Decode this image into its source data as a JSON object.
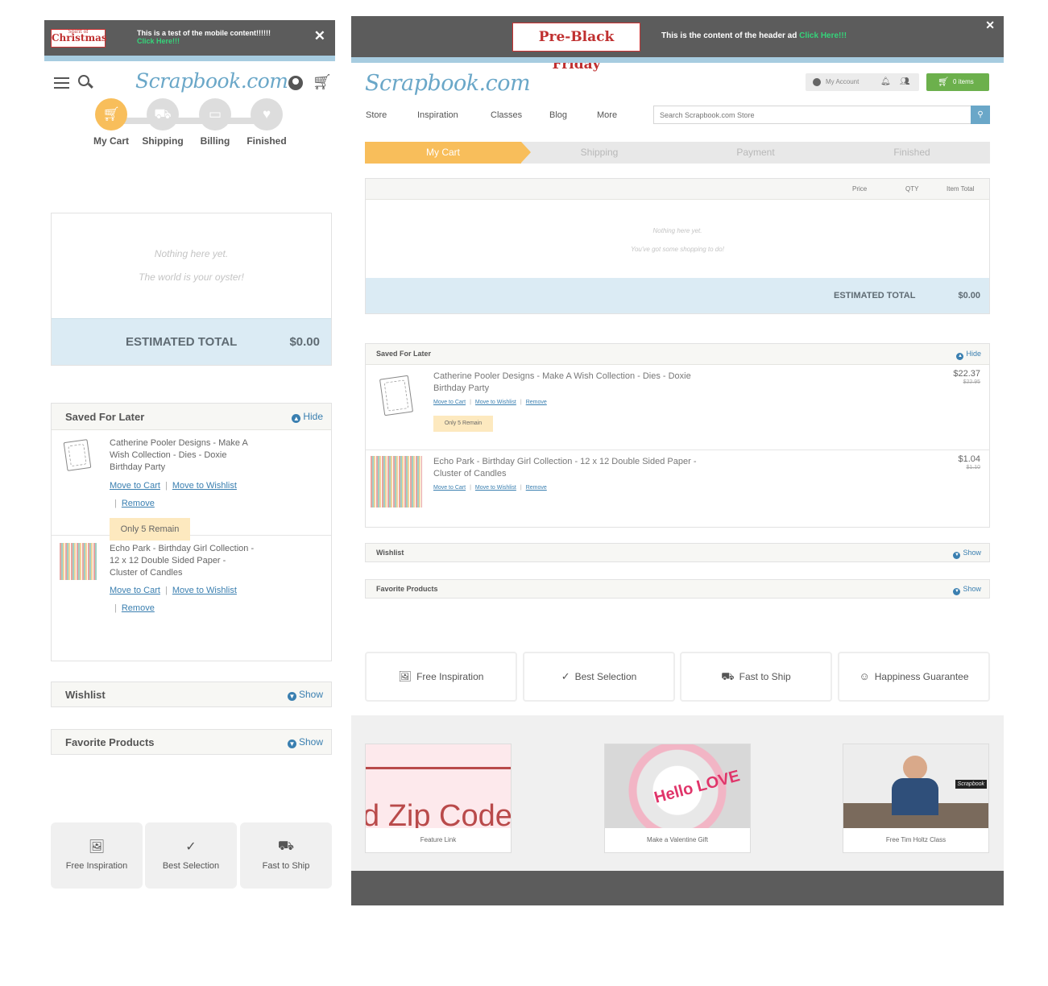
{
  "mobile": {
    "ad": {
      "logo_small": "Spirit of",
      "logo": "Christmas",
      "text": "This is a test of the mobile content!!!!!!",
      "link": "Click Here!!!",
      "close": "✕"
    },
    "logo": "Scrapbook.com",
    "steps": [
      "My Cart",
      "Shipping",
      "Billing",
      "Finished"
    ],
    "empty": {
      "line1": "Nothing here yet.",
      "line2": "The world is your oyster!"
    },
    "total": {
      "label": "ESTIMATED TOTAL",
      "value": "$0.00"
    },
    "saved": {
      "title": "Saved For Later",
      "toggle": "Hide",
      "items": [
        {
          "name": "Catherine Pooler Designs - Make A Wish Collection - Dies - Doxie Birthday Party",
          "move_cart": "Move to Cart",
          "move_wish": "Move to Wishlist",
          "remove": "Remove",
          "remain": "Only 5 Remain"
        },
        {
          "name": "Echo Park - Birthday Girl Collection - 12 x 12 Double Sided Paper - Cluster of Candles",
          "move_cart": "Move to Cart",
          "move_wish": "Move to Wishlist",
          "remove": "Remove"
        }
      ]
    },
    "wishlist": {
      "title": "Wishlist",
      "toggle": "Show"
    },
    "favorites": {
      "title": "Favorite Products",
      "toggle": "Show"
    },
    "features": [
      "Free Inspiration",
      "Best Selection",
      "Fast to Ship"
    ],
    "separator": "|"
  },
  "desktop": {
    "ad": {
      "logo": "Pre-Black Friday",
      "text": "This is the content of the header ad",
      "link": "Click Here!!!",
      "close": "✕"
    },
    "logo": "Scrapbook.com",
    "account": "My Account",
    "cart": "0 items",
    "nav": [
      "Store",
      "Inspiration",
      "Classes",
      "Blog",
      "More"
    ],
    "search_placeholder": "Search Scrapbook.com Store",
    "steps": [
      "My Cart",
      "Shipping",
      "Payment",
      "Finished"
    ],
    "cart_table": {
      "cols": [
        "Price",
        "QTY",
        "Item Total"
      ],
      "empty1": "Nothing here yet.",
      "empty2": "You've got some shopping to do!",
      "total_label": "ESTIMATED TOTAL",
      "total_value": "$0.00"
    },
    "saved": {
      "title": "Saved For Later",
      "toggle": "Hide",
      "items": [
        {
          "name": "Catherine Pooler Designs - Make A Wish Collection - Dies - Doxie Birthday Party",
          "move_cart": "Move to Cart",
          "move_wish": "Move to Wishlist",
          "remove": "Remove",
          "remain": "Only 5 Remain",
          "price": "$22.37",
          "old_price": "$22.95"
        },
        {
          "name": "Echo Park - Birthday Girl Collection - 12 x 12 Double Sided Paper - Cluster of Candles",
          "move_cart": "Move to Cart",
          "move_wish": "Move to Wishlist",
          "remove": "Remove",
          "price": "$1.04",
          "old_price": "$1.10"
        }
      ]
    },
    "wishlist": {
      "title": "Wishlist",
      "toggle": "Show"
    },
    "favorites": {
      "title": "Favorite Products",
      "toggle": "Show"
    },
    "features": [
      "Free Inspiration",
      "Best Selection",
      "Fast to Ship",
      "Happiness Guarantee"
    ],
    "promos": [
      {
        "caption": "Feature Link",
        "img_text": "d Zip Code"
      },
      {
        "caption": "Make a Valentine Gift",
        "img_text": "Hello LOVE"
      },
      {
        "caption": "Free Tim Holtz Class",
        "img_text": "Scrapbook"
      }
    ],
    "separator": "|"
  },
  "colors": {
    "accent": "#f8be5b",
    "brand_blue": "#6aa7c8",
    "link": "#3a7fb0",
    "cart_green": "#6cb04c",
    "ad_bg": "#5c5c5c",
    "total_bg": "#dbebf4"
  }
}
